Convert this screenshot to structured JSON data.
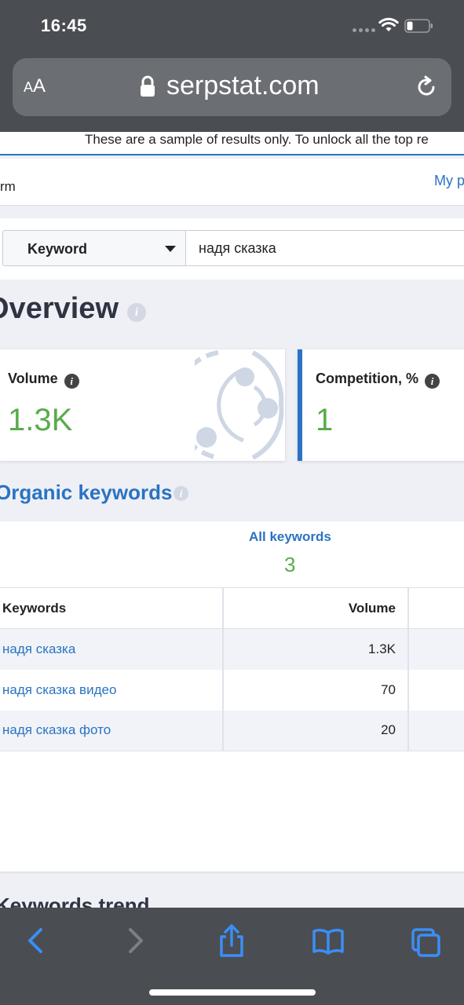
{
  "status_bar": {
    "time": "16:45"
  },
  "browser": {
    "text_size_label": "AA",
    "url": "serpstat.com"
  },
  "page": {
    "notice": "These are a sample of results only. To unlock all the top re",
    "header_left": "rm",
    "header_right": "My p",
    "search": {
      "type_label": "Keyword",
      "query": "надя сказка"
    },
    "overview": {
      "title": "Overview",
      "volume_label": "Volume",
      "volume_value": "1.3K",
      "competition_label": "Competition, %",
      "competition_value": "1"
    },
    "organic": {
      "title": "Organic keywords",
      "all_keywords_label": "All keywords",
      "all_keywords_count": "3",
      "columns": [
        "Keywords",
        "Volume",
        ""
      ],
      "rows": [
        {
          "keyword": "надя сказка",
          "volume": "1.3K"
        },
        {
          "keyword": "надя сказка видео",
          "volume": "70"
        },
        {
          "keyword": "надя сказка фото",
          "volume": "20"
        }
      ]
    },
    "next_section_partial": "Keywords trend"
  },
  "toolbar": {
    "icons": [
      "back-icon",
      "forward-icon",
      "share-icon",
      "bookmarks-icon",
      "tabs-icon"
    ]
  },
  "colors": {
    "accent_blue": "#2a73c2",
    "value_green": "#5aab4c",
    "chrome_gray": "#4a4d52",
    "ios_blue": "#3a8ef6"
  }
}
